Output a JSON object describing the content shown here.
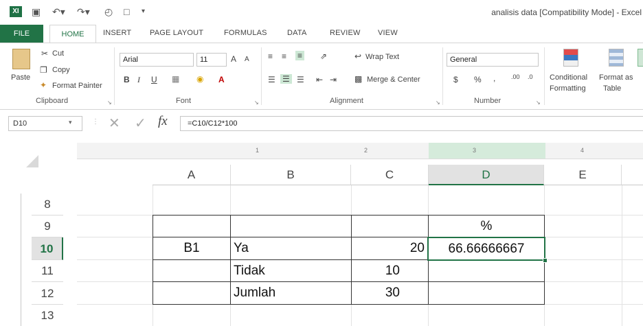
{
  "titlebar": {
    "app_icon": "XI",
    "title": "analisis data  [Compatibility Mode] - Excel"
  },
  "tabs": [
    "FILE",
    "HOME",
    "INSERT",
    "PAGE LAYOUT",
    "FORMULAS",
    "DATA",
    "REVIEW",
    "VIEW"
  ],
  "clipboard": {
    "paste": "Paste",
    "cut": "Cut",
    "copy": "Copy",
    "format_painter": "Format Painter",
    "label": "Clipboard"
  },
  "font": {
    "name": "Arial",
    "size": "11",
    "label": "Font",
    "bold": "B",
    "italic": "I",
    "underline": "U",
    "grow": "A",
    "shrink": "A",
    "color_letter": "A"
  },
  "alignment": {
    "wrap": "Wrap Text",
    "merge": "Merge & Center",
    "label": "Alignment"
  },
  "number": {
    "format": "General",
    "currency": "$",
    "percent": "%",
    "comma": ",",
    "inc_dec": ".00",
    "dec_dec": ".0",
    "label": "Number"
  },
  "styles": {
    "conditional_1": "Conditional",
    "conditional_2": "Formatting",
    "format_as_1": "Format as",
    "format_as_2": "Table"
  },
  "formula_bar": {
    "name_box": "D10",
    "fx": "fx",
    "formula": "=C10/C12*100"
  },
  "ruler": {
    "ticks": [
      "1",
      "2",
      "3",
      "4"
    ]
  },
  "columns": [
    "A",
    "B",
    "C",
    "D",
    "E"
  ],
  "rows": [
    "8",
    "9",
    "10",
    "11",
    "12",
    "13"
  ],
  "cells": {
    "D9": "%",
    "A10": "B1",
    "B10": "Ya",
    "C10": "20",
    "D10": "66.66666667",
    "B11": "Tidak",
    "C11": "10",
    "B12": "Jumlah",
    "C12": "30"
  }
}
